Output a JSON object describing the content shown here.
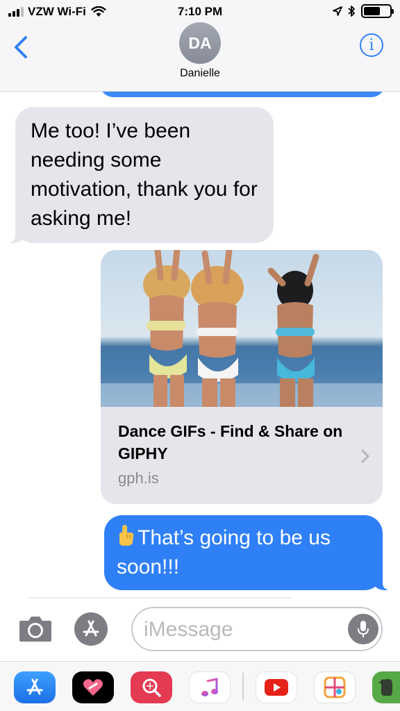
{
  "status_bar": {
    "carrier": "VZW Wi-Fi",
    "time": "7:10 PM",
    "battery_level": 0.65,
    "signal_bars": 3
  },
  "header": {
    "avatar_initials": "DA",
    "contact_name": "Danielle",
    "back_icon": "chevron-left-icon",
    "info_icon": "info-icon"
  },
  "messages": [
    {
      "type": "received",
      "text": "Me too! I’ve been needing some motivation, thank you for asking me!"
    },
    {
      "type": "sent-link",
      "title": "Dance GIFs - Find & Share on GIPHY",
      "domain": "gph.is"
    },
    {
      "type": "sent",
      "text": "That’s going to be us soon!!!"
    }
  ],
  "input": {
    "placeholder": "iMessage",
    "value": ""
  },
  "app_drawer": [
    "app-store-icon",
    "heart-sticker-icon",
    "search-images-icon",
    "music-icon",
    "youtube-icon",
    "photo-grid-icon",
    "evernote-icon"
  ],
  "colors": {
    "sent_bubble": "#2f80f6",
    "received_bubble": "#e6e5eb",
    "accent": "#2f80f6"
  }
}
